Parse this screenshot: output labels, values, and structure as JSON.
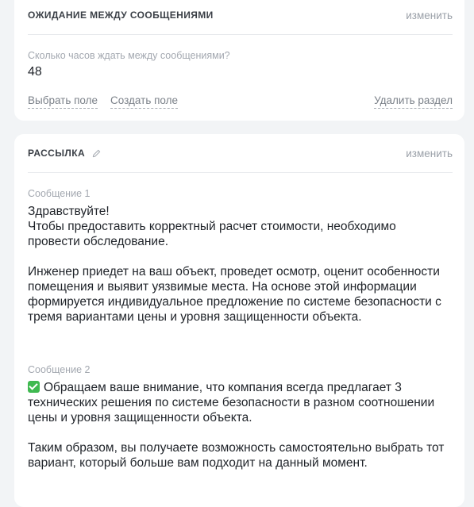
{
  "wait_section": {
    "title": "ОЖИДАНИЕ МЕЖДУ СООБЩЕНИЯМИ",
    "edit_label": "изменить",
    "field_label": "Сколько часов ждать между сообщениями?",
    "field_value": "48",
    "actions": {
      "select_field": "Выбрать поле",
      "create_field": "Создать поле",
      "delete_section": "Удалить раздел"
    }
  },
  "mailing_section": {
    "title": "РАССЫЛКА",
    "edit_label": "изменить",
    "messages": [
      {
        "label": "Сообщение 1",
        "text": "Здравствуйте!\nЧтобы предоставить корректный расчет стоимости, необходимо провести обследование.\n\nИнженер приедет на ваш объект, проведет осмотр, оценит особенности помещения и выявит уязвимые места. На основе этой информации формируется индивидуальное предложение по системе безопасности с тремя вариантами цены и уровня защищенности объекта."
      },
      {
        "label": "Сообщение 2",
        "icon": "check-mark-icon",
        "text": "Обращаем ваше внимание, что компания всегда предлагает 3 технических решения по системе безопасности в разном соотношении цены и уровня защищенности объекта.\n\nТаким образом, вы получаете возможность самостоятельно выбрать тот вариант, который больше вам подходит на данный момент."
      }
    ]
  }
}
